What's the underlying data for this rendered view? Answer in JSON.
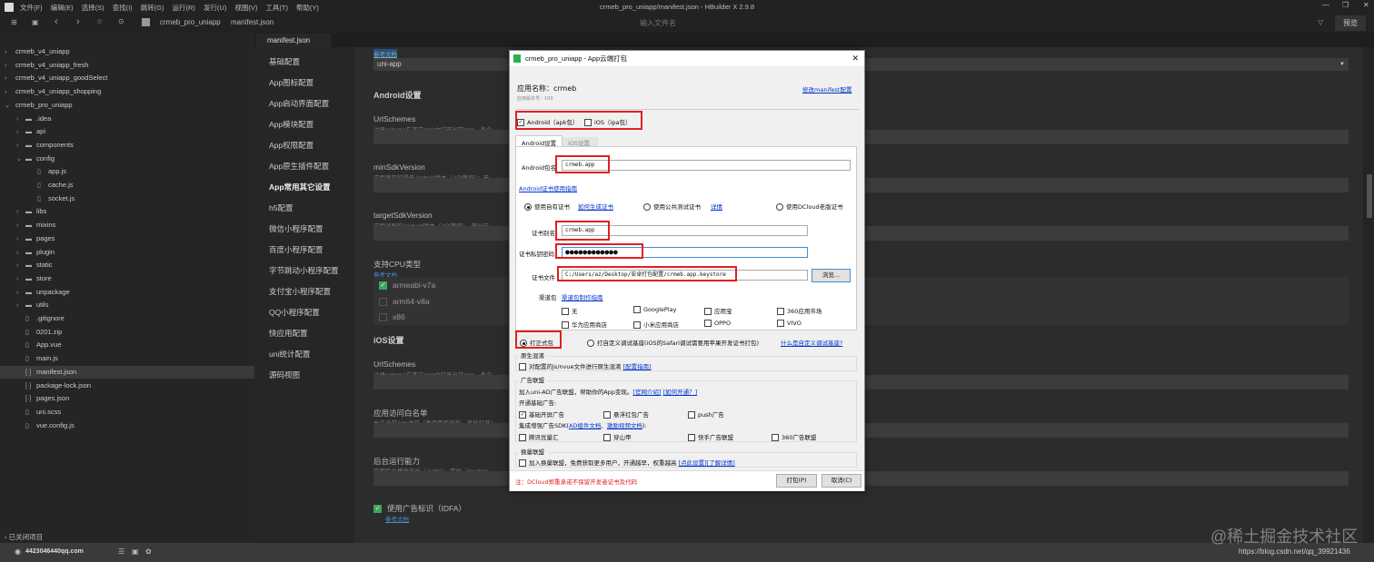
{
  "app": {
    "title": "crmeb_pro_uniapp/manifest.json - HBuilder X 2.9.8",
    "menus": [
      "文件(F)",
      "编辑(E)",
      "选择(S)",
      "查找(I)",
      "跳转(G)",
      "运行(R)",
      "发行(U)",
      "视图(V)",
      "工具(T)",
      "帮助(Y)"
    ],
    "breadcrumb": [
      "crmeb_pro_uniapp",
      "manifest.json"
    ],
    "search_placeholder": "输入文件名",
    "preview_label": "预览"
  },
  "sidebar": {
    "items": [
      {
        "label": "crmeb_v4_uniapp",
        "depth": 0,
        "type": "project",
        "chev": "›"
      },
      {
        "label": "crmeb_v4_uniapp_fresh",
        "depth": 0,
        "type": "project",
        "chev": "›"
      },
      {
        "label": "crmeb_v4_uniapp_goodSelect",
        "depth": 0,
        "type": "project",
        "chev": "›"
      },
      {
        "label": "crmeb_v4_uniapp_shopping",
        "depth": 0,
        "type": "project",
        "chev": "›"
      },
      {
        "label": "crmeb_pro_uniapp",
        "depth": 0,
        "type": "project",
        "chev": "⌄"
      },
      {
        "label": ".idea",
        "depth": 1,
        "type": "folder",
        "chev": "›"
      },
      {
        "label": "api",
        "depth": 1,
        "type": "folder",
        "chev": "›"
      },
      {
        "label": "components",
        "depth": 1,
        "type": "folder",
        "chev": "›"
      },
      {
        "label": "config",
        "depth": 1,
        "type": "folder",
        "chev": "⌄"
      },
      {
        "label": "app.js",
        "depth": 2,
        "type": "file",
        "chev": ""
      },
      {
        "label": "cache.js",
        "depth": 2,
        "type": "file",
        "chev": ""
      },
      {
        "label": "socket.js",
        "depth": 2,
        "type": "file",
        "chev": ""
      },
      {
        "label": "libs",
        "depth": 1,
        "type": "folder",
        "chev": "›"
      },
      {
        "label": "mixins",
        "depth": 1,
        "type": "folder",
        "chev": "›"
      },
      {
        "label": "pages",
        "depth": 1,
        "type": "folder",
        "chev": "›"
      },
      {
        "label": "plugin",
        "depth": 1,
        "type": "folder",
        "chev": "›"
      },
      {
        "label": "static",
        "depth": 1,
        "type": "folder",
        "chev": "›"
      },
      {
        "label": "store",
        "depth": 1,
        "type": "folder",
        "chev": "›"
      },
      {
        "label": "unpackage",
        "depth": 1,
        "type": "folder",
        "chev": "›"
      },
      {
        "label": "utils",
        "depth": 1,
        "type": "folder",
        "chev": "›"
      },
      {
        "label": ".gitignore",
        "depth": 1,
        "type": "file",
        "chev": ""
      },
      {
        "label": "0201.zip",
        "depth": 1,
        "type": "file",
        "chev": ""
      },
      {
        "label": "App.vue",
        "depth": 1,
        "type": "file",
        "chev": ""
      },
      {
        "label": "main.js",
        "depth": 1,
        "type": "file",
        "chev": ""
      },
      {
        "label": "manifest.json",
        "depth": 1,
        "type": "json",
        "chev": "",
        "selected": true
      },
      {
        "label": "package-lock.json",
        "depth": 1,
        "type": "json",
        "chev": ""
      },
      {
        "label": "pages.json",
        "depth": 1,
        "type": "json",
        "chev": ""
      },
      {
        "label": "uni.scss",
        "depth": 1,
        "type": "file",
        "chev": ""
      },
      {
        "label": "vue.config.js",
        "depth": 1,
        "type": "file",
        "chev": ""
      }
    ],
    "closed_projects": "已关闭项目"
  },
  "editor": {
    "tab": "manifest.json"
  },
  "nav": {
    "items": [
      "基础配置",
      "App图标配置",
      "App启动界面配置",
      "App模块配置",
      "App权限配置",
      "App原生插件配置",
      "App常用其它设置",
      "h5配置",
      "微信小程序配置",
      "百度小程序配置",
      "字节跳动小程序配置",
      "支付宝小程序配置",
      "QQ小程序配置",
      "快应用配置",
      "uni统计配置",
      "源码视图"
    ],
    "active": 6
  },
  "content": {
    "top_link": "参考文档",
    "select_value": "uni-app",
    "android_heading": "Android设置",
    "fields_android": [
      {
        "label": "UrlSchemes",
        "desc": "注册schema在其它App中打开当前App，多个"
      },
      {
        "label": "minSdkVersion",
        "desc": "应用兼容的最低Android版本（API等级）；参"
      },
      {
        "label": "targetSdkVersion",
        "desc": "应用适配的Android版本（API等级），部分应"
      }
    ],
    "cpu_label": "支持CPU类型",
    "cpu_link": "参考文档",
    "cpu": [
      {
        "label": "armeabi-v7a",
        "checked": true
      },
      {
        "label": "arm64-v8a",
        "checked": false
      },
      {
        "label": "x86",
        "checked": false
      }
    ],
    "ios_heading": "iOS设置",
    "fields_ios": [
      {
        "label": "UrlSchemes",
        "desc": "注册schema在其它App中打开当前App，多个"
      },
      {
        "label": "应用访问白名单",
        "desc": "允许当前App访问（查询是否安装、直接打开）"
      },
      {
        "label": "后台运行能力",
        "desc": "应用后台播放音乐（audio）、定位（location"
      }
    ],
    "idfa_label": "使用广告标识（IDFA）",
    "idfa_link": "参考文档"
  },
  "status": {
    "user": "4423046440qq.com"
  },
  "watermark": "@稀土掘金技术社区",
  "watermark2": "https://blog.csdn.net/qq_39921436",
  "dialog": {
    "title": "crmeb_pro_uniapp - App云端打包",
    "app_name": "应用名称：crmeb",
    "app_version": "应用版本号：100",
    "edit_link": "修改manifest配置",
    "android_cb": "Android（apk包）",
    "ios_cb": "iOS（ipa包）",
    "tab_android": "Android设置",
    "tab_ios": "iOS设置",
    "pkg_label": "Android包名",
    "pkg_value": "crmeb.app",
    "cert_guide": "Android证书使用指南",
    "r_own": "使用自有证书",
    "r_own_link": "如何生成证书",
    "r_public": "使用公共测试证书",
    "r_public_link": "详情",
    "r_dcloud": "使用DCloud老版证书",
    "alias_label": "证书别名",
    "alias_value": "crmeb.app",
    "pwd_label": "证书私钥密码",
    "pwd_value": "●●●●●●●●●●●●",
    "file_label": "证书文件",
    "file_value": "C:/Users/az/Desktop/安卓打包配置/crmeb.app.keystore",
    "browse": "浏览...",
    "channel_label": "渠道包",
    "channel_link": "渠道包制作指南",
    "channels": [
      "无",
      "GooglePlay",
      "应用宝",
      "360应用市场",
      "华为应用商店",
      "小米应用商店",
      "OPPO",
      "VIVO"
    ],
    "r_release": "打正式包",
    "r_custom": "打自定义调试基座(iOS的Safari调试需要用苹果开发证书打包)",
    "r_custom_link": "什么是自定义调试基座?",
    "obf_legend": "原生混淆",
    "obf_cb": "对配置的js/nvue文件进行原生混淆",
    "obf_link": "[配置指南]",
    "ad_legend": "广告联盟",
    "ad_text": "加入uni-AD广告联盟，帮助你的App变现。",
    "ad_link1": "[官网介绍]",
    "ad_link2": "[如何开通？]",
    "ad_basic": "开通基础广告:",
    "ad_basic_items": [
      {
        "label": "基础开屏广告",
        "checked": true
      },
      {
        "label": "悬浮红包广告",
        "checked": false
      },
      {
        "label": "push广告",
        "checked": false
      }
    ],
    "ad_sdk_pre": "集成增强广告SDK(",
    "ad_sdk_link1": "AD组件文档",
    "ad_sdk_sep": "、",
    "ad_sdk_link2": "激励视频文档",
    "ad_sdk_post": "):",
    "ad_sdk_items": [
      "腾讯优量汇",
      "穿山甲",
      "快手广告联盟",
      "360广告联盟"
    ],
    "swap_legend": "换量联盟",
    "swap_cb": "加入换量联盟，免费获取更多用户，开通越早，权重越高",
    "swap_link1": "[点此设置]",
    "swap_link2": "[了解详情]",
    "note": "注：DCloud郑重承诺不保留开发者证书及代码",
    "pack_btn": "打包(P)",
    "cancel_btn": "取消(C)"
  }
}
